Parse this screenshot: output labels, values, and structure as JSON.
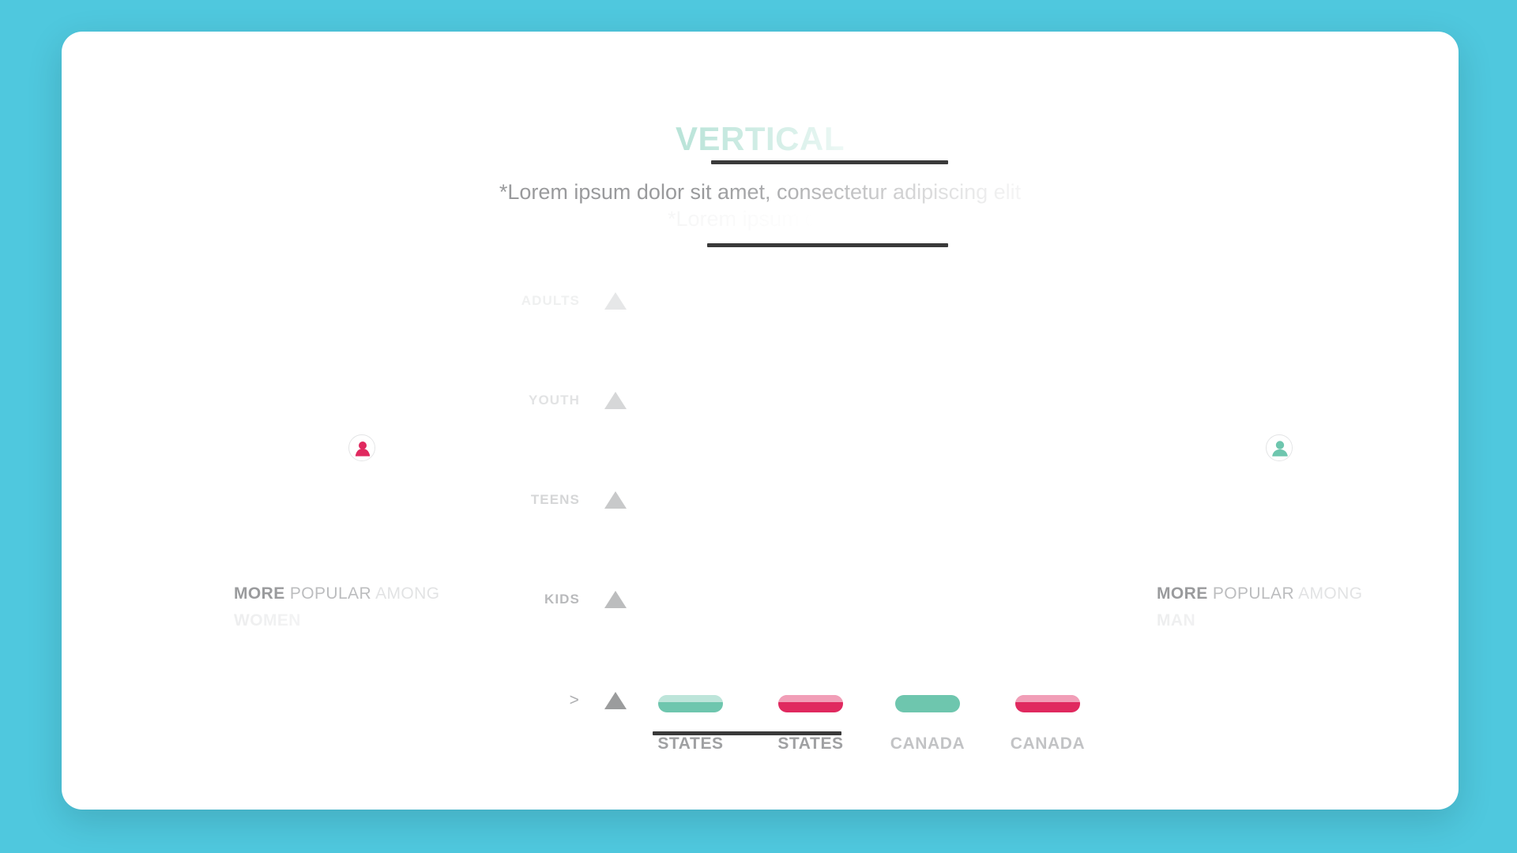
{
  "theme": {
    "background": "#4fc8de",
    "card": "#ffffff",
    "rule": "#3a3a3a",
    "title_color": "#7fcdb8",
    "green": "#6ec6ae",
    "pink": "#e0295f",
    "muted": "#c9cacb"
  },
  "header": {
    "title": "VERTICAL",
    "subtitle_line_1": "*Lorem ipsum dolor sit amet, consectetur adipiscing elit",
    "subtitle_line_2": "*Lorem ipsum dolor"
  },
  "axis": {
    "rows": [
      {
        "label": "ADULTS",
        "marker": "triangle-up-icon"
      },
      {
        "label": "YOUTH",
        "marker": "triangle-up-icon"
      },
      {
        "label": "TEENS",
        "marker": "triangle-up-icon"
      },
      {
        "label": "KIDS",
        "marker": "triangle-up-icon"
      },
      {
        "label": ">",
        "marker": "triangle-up-icon"
      }
    ]
  },
  "sides": {
    "left": {
      "icon": "female-avatar-icon",
      "icon_color": "#e0295f",
      "caption_strong": "MORE",
      "caption_mid": " POPULAR",
      "caption_weak": " AMONG",
      "caption_line_2": "WOMEN"
    },
    "right": {
      "icon": "male-avatar-icon",
      "icon_color": "#6ec6ae",
      "caption_strong": "MORE",
      "caption_mid": " POPULAR",
      "caption_weak": " AMONG",
      "caption_line_2": "MAN"
    }
  },
  "chart_data": {
    "type": "bar",
    "title": "VERTICAL",
    "subtitle": "*Lorem ipsum dolor sit amet, consectetur adipiscing elit",
    "xlabel": "",
    "ylabel": "",
    "grid": false,
    "legend_position": "none",
    "categories": [
      "STATES",
      "STATES",
      "CANADA",
      "CANADA"
    ],
    "y_tick_labels": [
      ">",
      "KIDS",
      "TEENS",
      "YOUTH",
      "ADULTS"
    ],
    "series": [
      {
        "name": "women",
        "color": "#e0295f"
      },
      {
        "name": "men",
        "color": "#6ec6ae"
      }
    ],
    "bars": [
      {
        "label": "STATES",
        "color": "#6ec6ae",
        "series": "men",
        "value": 0
      },
      {
        "label": "STATES",
        "color": "#e0295f",
        "series": "women",
        "value": 0
      },
      {
        "label": "CANADA",
        "color": "#6ec6ae",
        "series": "men",
        "value": 0
      },
      {
        "label": "CANADA",
        "color": "#e0295f",
        "series": "women",
        "value": 0
      }
    ]
  }
}
